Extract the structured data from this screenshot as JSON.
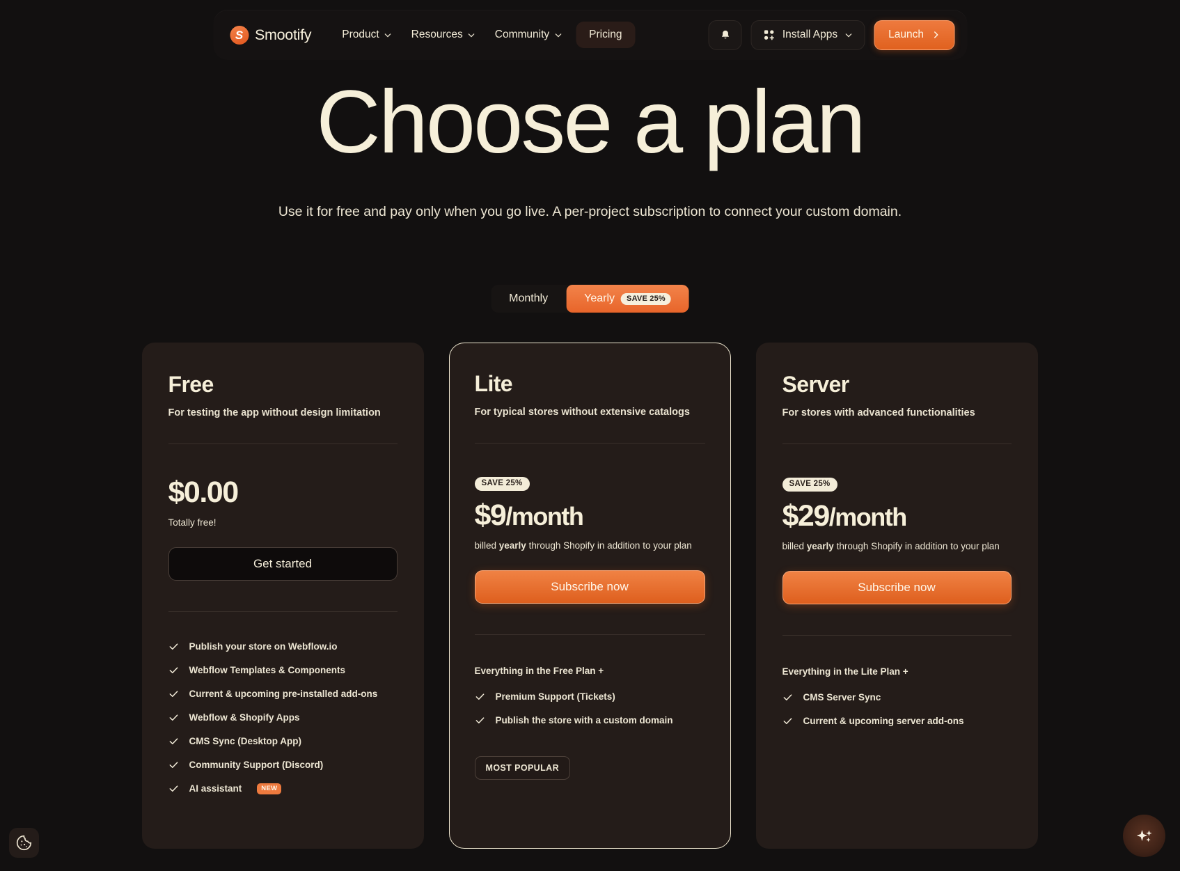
{
  "colors": {
    "page_bg": "#121010",
    "card_bg": "#241C19",
    "cream": "#F6EFD9",
    "accent_orange": "#E8652A",
    "accent_orange_light": "#F2834A"
  },
  "nav": {
    "brand": {
      "mark": "S",
      "name": "Smootify"
    },
    "links": [
      {
        "label": "Product",
        "icon": "chevron-down-icon"
      },
      {
        "label": "Resources",
        "icon": "chevron-down-icon"
      },
      {
        "label": "Community",
        "icon": "chevron-down-icon"
      }
    ],
    "pricing_label": "Pricing",
    "bell_icon": "bell-icon",
    "install": {
      "label": "Install Apps",
      "icon": "apps-grid-icon",
      "chevron": "chevron-down-icon"
    },
    "launch": {
      "label": "Launch",
      "icon": "chevron-right-icon"
    }
  },
  "hero": {
    "title": "Choose a plan",
    "subtitle": "Use it for free and pay only when you go live. A per-project subscription to connect your custom domain."
  },
  "billing_toggle": {
    "monthly_label": "Monthly",
    "yearly_label": "Yearly",
    "yearly_badge": "SAVE 25%",
    "selected": "Yearly"
  },
  "plans": [
    {
      "name": "Free",
      "tagline": "For testing the app without design limitation",
      "save_badge": null,
      "price": "$0.00",
      "price_unit": "",
      "price_note_plain": "Totally free!",
      "price_note_prefix": null,
      "price_note_bold": null,
      "price_note_suffix": null,
      "cta_label": "Get started",
      "cta_style": "ghost",
      "features_heading": null,
      "features": [
        {
          "label": "Publish your store on Webflow.io",
          "badge": null
        },
        {
          "label": "Webflow Templates & Components",
          "badge": null
        },
        {
          "label": "Current & upcoming pre-installed add-ons",
          "badge": null
        },
        {
          "label": "Webflow & Shopify Apps",
          "badge": null
        },
        {
          "label": "CMS Sync (Desktop App)",
          "badge": null
        },
        {
          "label": "Community Support (Discord)",
          "badge": null
        },
        {
          "label": "AI assistant",
          "badge": "NEW"
        }
      ],
      "popular_chip": null,
      "featured": false
    },
    {
      "name": "Lite",
      "tagline": "For typical stores without extensive catalogs",
      "save_badge": "SAVE 25%",
      "price": "$9",
      "price_unit": "/month",
      "price_note_plain": null,
      "price_note_prefix": "billed ",
      "price_note_bold": "yearly",
      "price_note_suffix": " through Shopify in addition to your plan",
      "cta_label": "Subscribe now",
      "cta_style": "primary",
      "features_heading": "Everything in the Free Plan +",
      "features": [
        {
          "label": "Premium Support (Tickets)",
          "badge": null
        },
        {
          "label": "Publish the store with a custom domain",
          "badge": null
        }
      ],
      "popular_chip": "MOST POPULAR",
      "featured": true
    },
    {
      "name": "Server",
      "tagline": "For stores with advanced functionalities",
      "save_badge": "SAVE 25%",
      "price": "$29",
      "price_unit": "/month",
      "price_note_plain": null,
      "price_note_prefix": "billed ",
      "price_note_bold": "yearly",
      "price_note_suffix": " through Shopify in addition to your plan",
      "cta_label": "Subscribe now",
      "cta_style": "primary",
      "features_heading": "Everything in the Lite Plan +",
      "features": [
        {
          "label": "CMS Server Sync",
          "badge": null
        },
        {
          "label": "Current & upcoming server add-ons",
          "badge": null
        }
      ],
      "popular_chip": null,
      "featured": false
    }
  ],
  "floating": {
    "cookie_icon": "cookie-icon",
    "ai_icon": "sparkles-icon"
  }
}
